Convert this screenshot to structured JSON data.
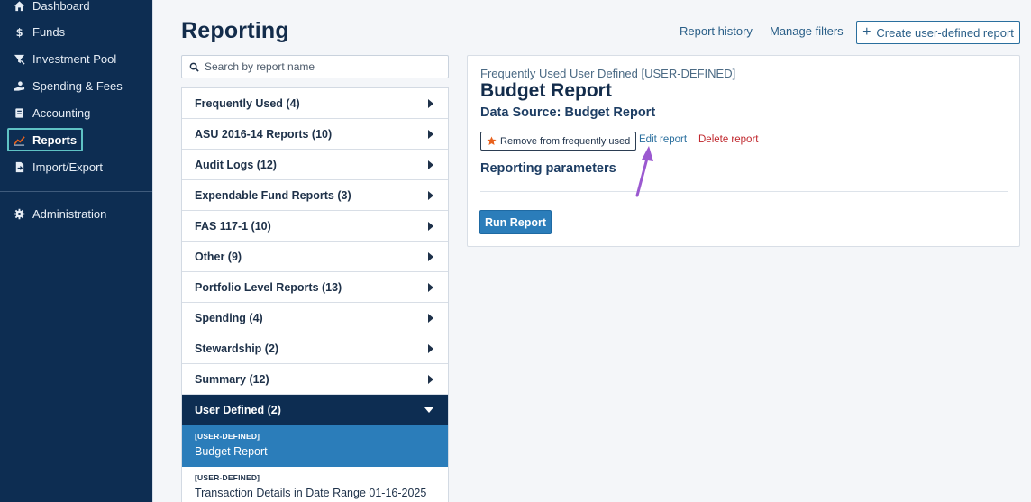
{
  "sidebar": {
    "items": [
      {
        "label": "Dashboard",
        "icon": "home-icon"
      },
      {
        "label": "Funds",
        "icon": "dollar-icon"
      },
      {
        "label": "Investment Pool",
        "icon": "funnel-icon"
      },
      {
        "label": "Spending & Fees",
        "icon": "hand-coin-icon"
      },
      {
        "label": "Accounting",
        "icon": "ledger-icon"
      },
      {
        "label": "Reports",
        "icon": "line-chart-icon",
        "active": true
      },
      {
        "label": "Import/Export",
        "icon": "file-transfer-icon"
      },
      {
        "label": "Administration",
        "icon": "gear-icon"
      }
    ]
  },
  "header": {
    "title": "Reporting",
    "report_history": "Report history",
    "manage_filters": "Manage filters",
    "create_report": "Create user-defined report"
  },
  "search": {
    "placeholder": "Search by report name"
  },
  "categories": [
    "Frequently Used (4)",
    "ASU 2016-14 Reports (10)",
    "Audit Logs (12)",
    "Expendable Fund Reports (3)",
    "FAS 117-1 (10)",
    "Other (9)",
    "Portfolio Level Reports (13)",
    "Spending (4)",
    "Stewardship (2)",
    "Summary (12)",
    "User Defined (2)"
  ],
  "user_defined_reports": [
    {
      "tag": "[USER-DEFINED]",
      "name": "Budget Report"
    },
    {
      "tag": "[USER-DEFINED]",
      "name": "Transaction Details in Date Range 01-16-2025"
    }
  ],
  "detail": {
    "kicker": "Frequently Used User Defined [USER-DEFINED]",
    "title": "Budget Report",
    "data_source": "Data Source: Budget Report",
    "remove_label": "Remove from frequently used",
    "edit_label": "Edit report",
    "delete_label": "Delete report",
    "params_heading": "Reporting parameters",
    "run_label": "Run Report"
  },
  "colors": {
    "sidebar_bg": "#0d2d52",
    "active_outline": "#5fc2c4",
    "primary_button": "#2b7dba",
    "delete_red": "#c0272d",
    "star_orange": "#e8611c",
    "annotation_arrow": "#9b59d0"
  }
}
